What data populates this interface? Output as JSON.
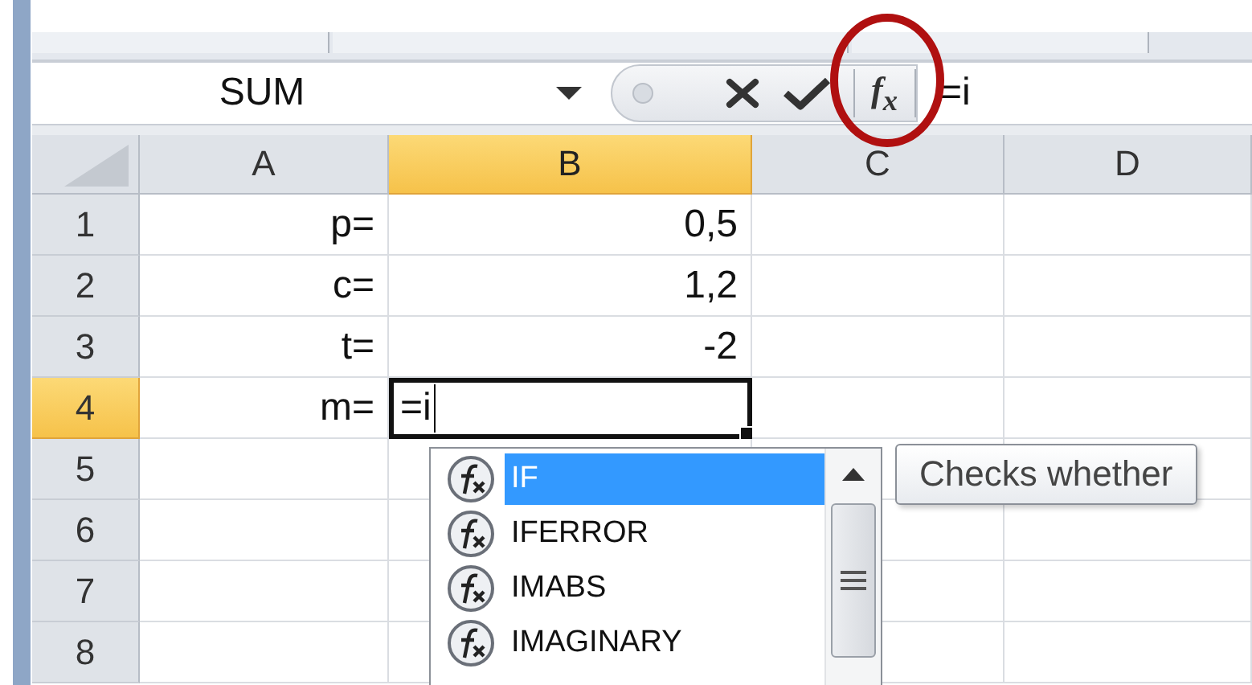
{
  "name_box": "SUM",
  "insert_function_label": "f$_{x}$",
  "formula": "=i",
  "columns": [
    {
      "label": "A",
      "selected": false
    },
    {
      "label": "B",
      "selected": true
    },
    {
      "label": "C",
      "selected": false
    },
    {
      "label": "D",
      "selected": false
    }
  ],
  "rows": [
    {
      "header": "1",
      "selected": false,
      "label": "p=",
      "value": "0,5",
      "editing": false
    },
    {
      "header": "2",
      "selected": false,
      "label": "c=",
      "value": "1,2",
      "editing": false
    },
    {
      "header": "3",
      "selected": false,
      "label": "t=",
      "value": "-2",
      "editing": false
    },
    {
      "header": "4",
      "selected": true,
      "label": "m=",
      "value": "=i",
      "editing": true
    },
    {
      "header": "5",
      "selected": false,
      "editing": false
    },
    {
      "header": "6",
      "selected": false,
      "editing": false
    },
    {
      "header": "7",
      "selected": false,
      "editing": false
    },
    {
      "header": "8",
      "selected": false,
      "editing": false
    }
  ],
  "autocomplete": {
    "items": [
      {
        "name": "IF",
        "selected": true
      },
      {
        "name": "IFERROR",
        "selected": false
      },
      {
        "name": "IMABS",
        "selected": false
      },
      {
        "name": "IMAGINARY",
        "selected": false
      }
    ]
  },
  "tooltip": "Checks whether"
}
